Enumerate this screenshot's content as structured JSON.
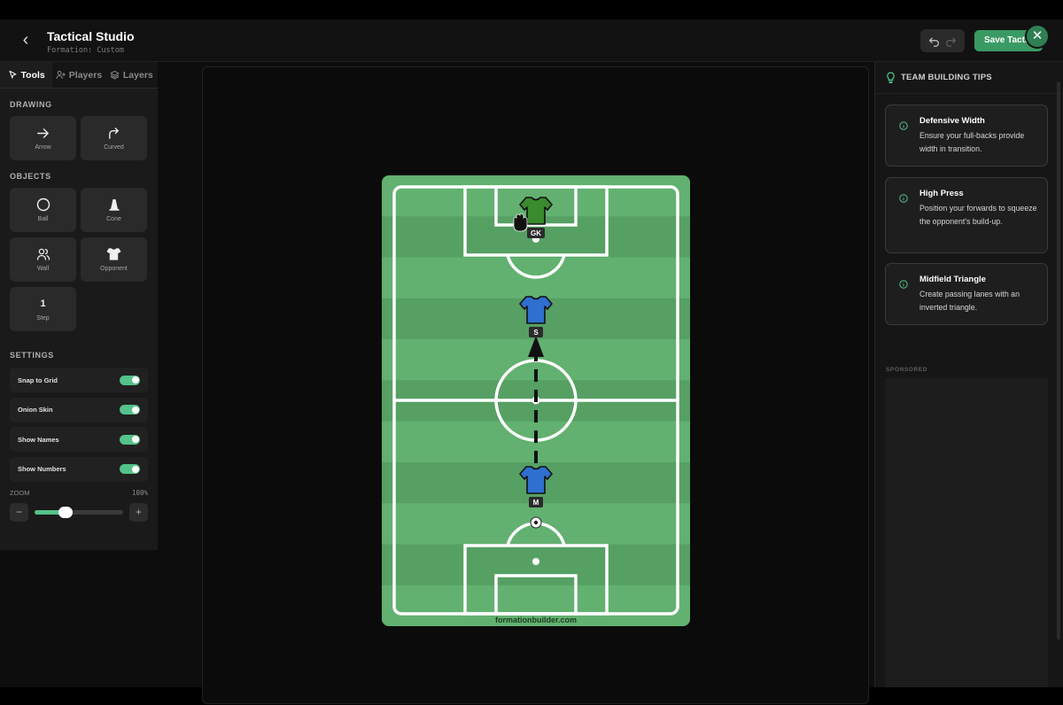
{
  "app": {
    "title": "Tactical Studio",
    "subtitle": "Formation: Custom",
    "save_label": "Save Tactic",
    "accent": "#3a9a63"
  },
  "tabs": [
    {
      "label": "Tools",
      "icon": "pointer-icon",
      "active": true
    },
    {
      "label": "Players",
      "icon": "user-plus-icon"
    },
    {
      "label": "Layers",
      "icon": "layers-icon"
    }
  ],
  "drawing": {
    "title": "DRAWING",
    "items": [
      {
        "label": "Arrow",
        "icon": "arrow-right-icon"
      },
      {
        "label": "Curved",
        "icon": "curved-arrow-icon"
      }
    ]
  },
  "objects": {
    "title": "OBJECTS",
    "items": [
      {
        "label": "Ball",
        "icon": "circle-icon"
      },
      {
        "label": "Cone",
        "icon": "cone-icon"
      },
      {
        "label": "Wall",
        "icon": "users-icon"
      },
      {
        "label": "Opponent",
        "icon": "shirt-icon"
      },
      {
        "label": "Step",
        "number": "1"
      }
    ]
  },
  "settings": {
    "title": "SETTINGS",
    "items": [
      {
        "label": "Snap to Grid",
        "on": true
      },
      {
        "label": "Onion Skin",
        "on": true
      },
      {
        "label": "Show Names",
        "on": true
      },
      {
        "label": "Show Numbers",
        "on": true
      }
    ],
    "zoom_label": "ZOOM",
    "zoom_value": "100%",
    "zoom_fraction": 0.35
  },
  "pitch": {
    "watermark": "formationbuilder.com",
    "grass_light": "#62b170",
    "grass_dark": "#56a064",
    "players": [
      {
        "label": "GK",
        "team": "goalkeeper",
        "color": "#3a8a2e"
      },
      {
        "label": "S",
        "team": "home",
        "color": "#2f6fd0"
      },
      {
        "label": "M",
        "team": "home",
        "color": "#2f6fd0"
      }
    ]
  },
  "tips": {
    "title": "TEAM BUILDING TIPS",
    "items": [
      {
        "title": "Defensive Width",
        "body": "Ensure your full-backs provide width in transition."
      },
      {
        "title": "High Press",
        "body": "Position your forwards to squeeze the opponent's build-up."
      },
      {
        "title": "Midfield Triangle",
        "body": "Create passing lanes with an inverted triangle."
      }
    ],
    "sponsored_label": "SPONSORED"
  }
}
